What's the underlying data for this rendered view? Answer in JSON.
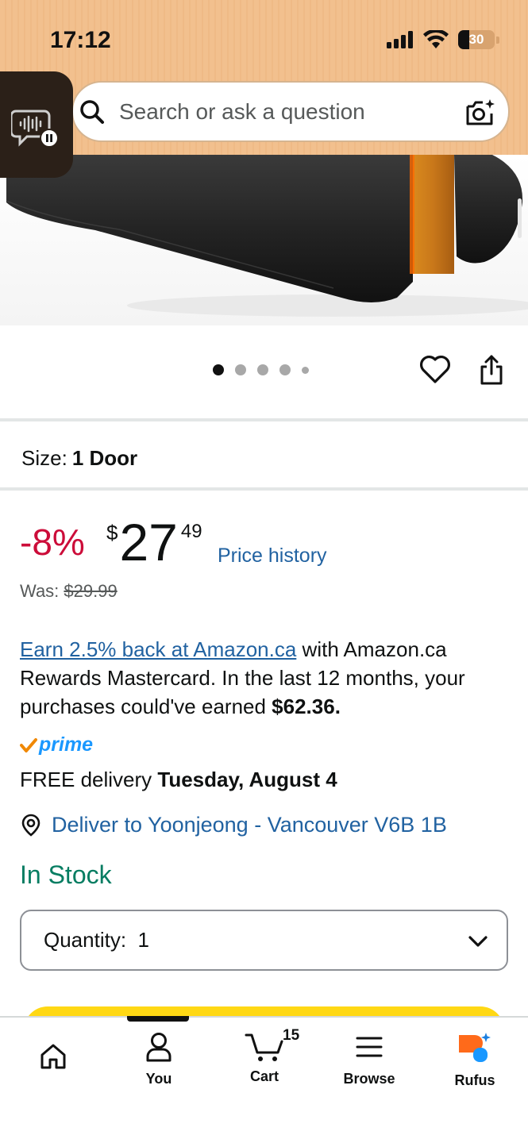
{
  "status_bar": {
    "time": "17:12",
    "battery": "30"
  },
  "search": {
    "placeholder": "Search or ask a question"
  },
  "carousel": {
    "total_images": 5,
    "active_index": 0
  },
  "size": {
    "label": "Size:",
    "value": "1 Door"
  },
  "pricing": {
    "discount": "-8%",
    "currency": "$",
    "whole": "27",
    "fraction": "49",
    "price_history_link": "Price history",
    "was_label": "Was:",
    "was_price": "$29.99"
  },
  "rewards": {
    "link_text": "Earn 2.5% back at Amazon.ca",
    "text_part1": " with Amazon.ca Rewards Mastercard. In the last 12 months, your purchases could've earned ",
    "earned_amount": "$62.36."
  },
  "prime": {
    "label": "prime"
  },
  "delivery": {
    "prefix": "FREE delivery ",
    "date": "Tuesday, August 4"
  },
  "deliver_to": {
    "text": "Deliver to Yoonjeong - Vancouver V6B 1B"
  },
  "stock": {
    "status": "In Stock"
  },
  "quantity": {
    "label": "Quantity:",
    "value": "1"
  },
  "bottom_nav": {
    "items": [
      {
        "label": "",
        "icon": "home-icon"
      },
      {
        "label": "You",
        "icon": "person-icon"
      },
      {
        "label": "Cart",
        "icon": "cart-icon",
        "count": "15"
      },
      {
        "label": "Browse",
        "icon": "menu-icon"
      },
      {
        "label": "Rufus",
        "icon": "rufus-icon"
      }
    ]
  },
  "colors": {
    "header_bg": "#f2c08e",
    "discount_red": "#cc0c39",
    "link_blue": "#2162a1",
    "stock_green": "#067d62",
    "prime_blue": "#1a98ff",
    "button_yellow": "#ffd814"
  }
}
